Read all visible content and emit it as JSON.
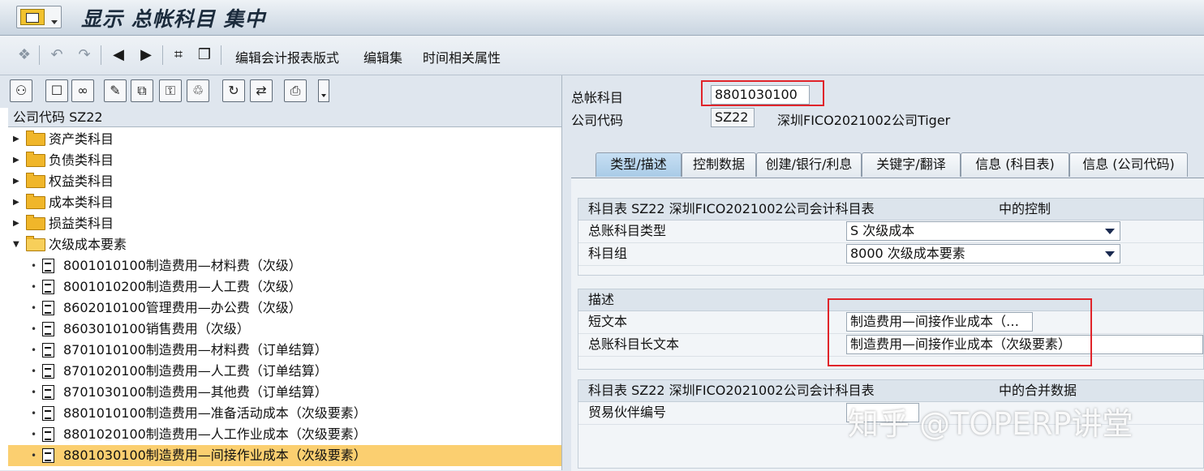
{
  "window": {
    "title": "显示 总帐科目 集中"
  },
  "toolbar": {
    "actions": [
      "编辑会计报表版式",
      "编辑集",
      "时间相关属性"
    ]
  },
  "tree": {
    "header": "公司代码 SZ22",
    "folders": [
      "资产类科目",
      "负债类科目",
      "权益类科目",
      "成本类科目",
      "损益类科目",
      "次级成本要素"
    ],
    "items": [
      "8001010100制造费用—材料费（次级）",
      "8001010200制造费用—人工费（次级）",
      "8602010100管理费用—办公费（次级）",
      "8603010100销售费用（次级）",
      "8701010100制造费用—材料费（订单结算）",
      "8701020100制造费用—人工费（订单结算）",
      "8701030100制造费用—其他费（订单结算）",
      "8801010100制造费用—准备活动成本（次级要素）",
      "8801020100制造费用—人工作业成本（次级要素）",
      "8801030100制造费用—间接作业成本（次级要素）"
    ],
    "selected_index": 9
  },
  "header_fields": {
    "gl_account_label": "总帐科目",
    "gl_account_value": "8801030100",
    "company_code_label": "公司代码",
    "company_code_value": "SZ22",
    "company_name": "深圳FICO2021002公司Tiger"
  },
  "tabs": [
    "类型/描述",
    "控制数据",
    "创建/银行/利息",
    "关键字/翻译",
    "信息 (科目表)",
    "信息 (公司代码)"
  ],
  "active_tab": 0,
  "group_control": {
    "title": "科目表 SZ22 深圳FICO2021002公司会计科目表",
    "title_suffix": "中的控制",
    "account_type_label": "总账科目类型",
    "account_type_value": "S 次级成本",
    "account_group_label": "科目组",
    "account_group_value": "8000 次级成本要素"
  },
  "group_description": {
    "title": "描述",
    "short_text_label": "短文本",
    "short_text_value": "制造费用—间接作业成本（…",
    "long_text_label": "总账科目长文本",
    "long_text_value": "制造费用—间接作业成本（次级要素）"
  },
  "group_consolidation": {
    "title": "科目表 SZ22 深圳FICO2021002公司会计科目表",
    "title_suffix": "中的合并数据",
    "trading_partner_label": "贸易伙伴编号",
    "trading_partner_value": ""
  },
  "watermark": "知乎 @TOPERP讲堂",
  "colors": {
    "selection": "#fbcf70",
    "highlight_box": "#e0242a",
    "active_tab": "#a9cbe7"
  }
}
